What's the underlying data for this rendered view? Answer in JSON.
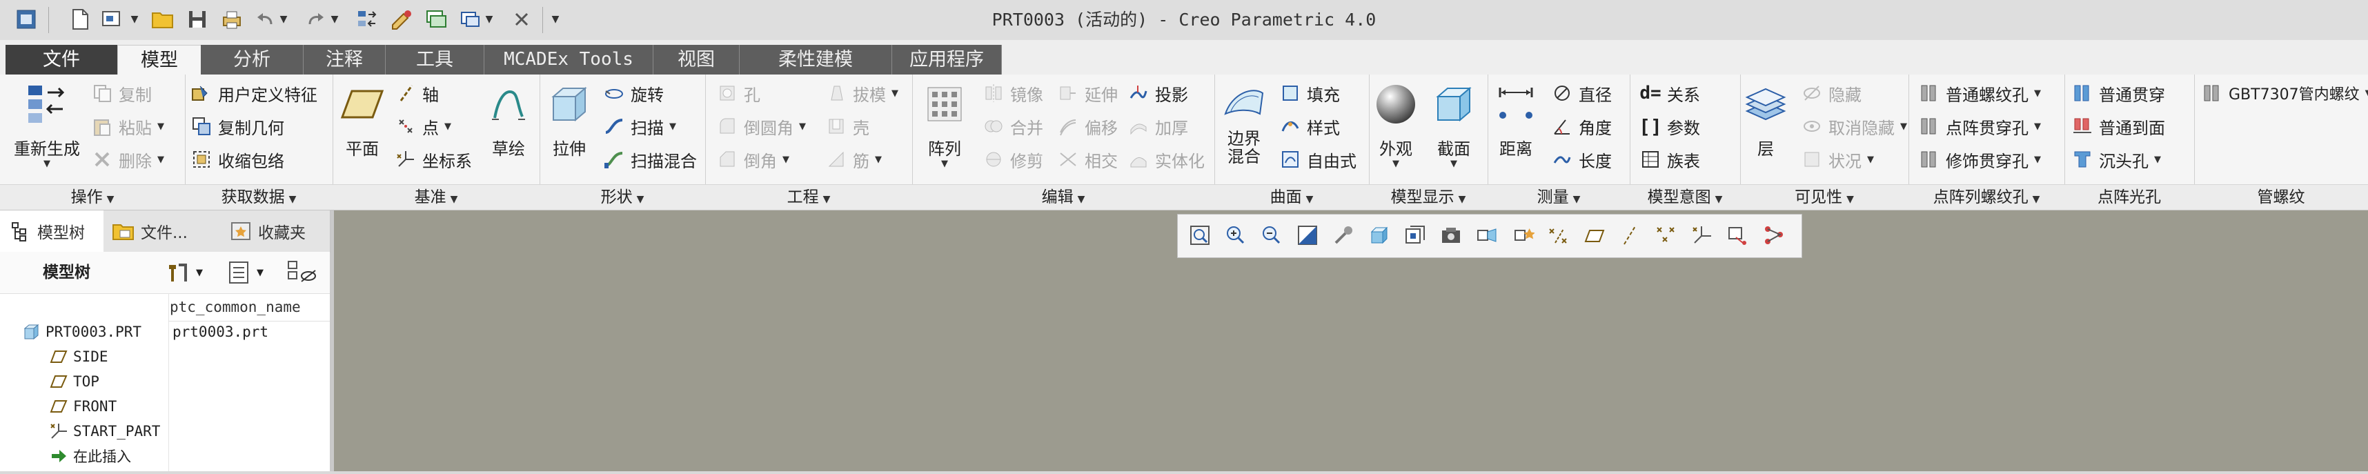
{
  "window": {
    "title": "PRT0003 (活动的) - Creo Parametric 4.0"
  },
  "quick_access": {
    "icons": [
      "app-menu-icon",
      "new-icon",
      "open-dropdown-icon",
      "open-folder-icon",
      "save-icon",
      "print-icon",
      "undo-icon",
      "redo-icon",
      "regenerate-icon",
      "windows-icon",
      "close-window-icon",
      "customize-icon"
    ]
  },
  "tabs": [
    {
      "label": "文件"
    },
    {
      "label": "模型"
    },
    {
      "label": "分析"
    },
    {
      "label": "注释"
    },
    {
      "label": "工具"
    },
    {
      "label": "MCADEx Tools"
    },
    {
      "label": "视图"
    },
    {
      "label": "柔性建模"
    },
    {
      "label": "应用程序"
    }
  ],
  "ribbon": {
    "operations": {
      "label": "操作",
      "regenerate": "重新生成",
      "copy": "复制",
      "paste": "粘贴",
      "delete": "删除"
    },
    "get_data": {
      "label": "获取数据",
      "udf": "用户定义特征",
      "copy_geom": "复制几何",
      "shrinkwrap": "收缩包络"
    },
    "datum": {
      "label": "基准",
      "plane": "平面",
      "axis": "轴",
      "point": "点",
      "csys": "坐标系",
      "sketch": "草绘"
    },
    "shapes": {
      "label": "形状",
      "extrude": "拉伸",
      "revolve": "旋转",
      "sweep": "扫描",
      "swept_blend": "扫描混合"
    },
    "engineering": {
      "label": "工程",
      "hole": "孔",
      "round": "倒圆角",
      "chamfer": "倒角",
      "draft": "拔模",
      "shell": "壳",
      "rib": "筋"
    },
    "editing": {
      "label": "编辑",
      "pattern": "阵列",
      "mirror": "镜像",
      "merge": "合并",
      "trim": "修剪",
      "extend": "延伸",
      "offset": "偏移",
      "intersect": "相交",
      "project": "投影",
      "thicken": "加厚",
      "solidify": "实体化"
    },
    "surfaces": {
      "label": "曲面",
      "boundary_blend": "边界",
      "boundary_blend2": "混合",
      "fill": "填充",
      "style": "样式",
      "freestyle": "自由式"
    },
    "model_display": {
      "label": "模型显示",
      "appearance": "外观",
      "section": "截面"
    },
    "measure": {
      "label": "测量",
      "distance": "距离",
      "diameter": "直径",
      "angle": "角度",
      "length": "长度"
    },
    "model_intent": {
      "label": "模型意图",
      "relations": "关系",
      "parameters": "参数",
      "family_table": "族表"
    },
    "visibility": {
      "label": "可见性",
      "layers": "层",
      "hide": "隐藏",
      "unhide": "取消隐藏",
      "status": "状况"
    },
    "point_tapped": {
      "label": "点阵列螺纹孔",
      "normal": "普通螺纹孔",
      "array": "点阵贯穿孔",
      "decorative": "修饰贯穿孔"
    },
    "point_clearance": {
      "label": "点阵光孔",
      "through": "普通贯穿",
      "to_face": "普通到面",
      "counterbore": "沉头孔"
    },
    "pipe_thread": {
      "label": "管螺纹",
      "gbt": "GBT7307管内螺纹"
    }
  },
  "left_panel": {
    "tabs": [
      {
        "label": "模型树"
      },
      {
        "label": "文件..."
      },
      {
        "label": "收藏夹"
      }
    ],
    "tree_title": "模型树",
    "column_header": "ptc_common_name",
    "items": [
      {
        "label": "PRT0003.PRT",
        "value": "prt0003.prt",
        "icon": "part-icon"
      },
      {
        "label": "SIDE",
        "icon": "datum-plane-icon"
      },
      {
        "label": "TOP",
        "icon": "datum-plane-icon"
      },
      {
        "label": "FRONT",
        "icon": "datum-plane-icon"
      },
      {
        "label": "START_PART",
        "icon": "csys-icon"
      },
      {
        "label": "在此插入",
        "icon": "insert-here-arrow-icon"
      }
    ]
  },
  "view_toolbar": {
    "icons": [
      "refit-icon",
      "zoom-in-icon",
      "zoom-out-icon",
      "repaint-icon",
      "spin-center-icon",
      "display-style-icon",
      "saved-orientations-icon",
      "view-manager-icon",
      "perspective-icon",
      "annotation-display-icon",
      "plane-display-icon",
      "axis-display-icon",
      "point-display-icon",
      "csys-display-icon",
      "spin-display-icon",
      "annotation-orient-icon"
    ]
  },
  "colors": {
    "graphics_background": "#9c9b8f",
    "tab_bar_dark": "#5e5e5e",
    "file_tab": "#3f3f3f",
    "ribbon_background": "#f5f5f5"
  }
}
